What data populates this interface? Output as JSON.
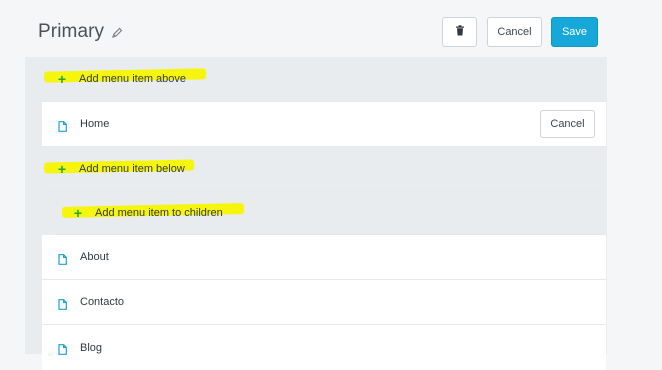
{
  "header": {
    "title": "Primary",
    "title_icon": "pencil-icon",
    "delete_icon": "trash-icon",
    "cancel_label": "Cancel",
    "save_label": "Save"
  },
  "menu": {
    "add_above": "Add menu item above",
    "items": [
      {
        "label": "Home",
        "icon": "page-icon",
        "action_label": "Cancel"
      }
    ],
    "add_below": "Add menu item below",
    "add_children": "Add menu item to children",
    "more_items": [
      {
        "label": "About",
        "icon": "page-icon"
      },
      {
        "label": "Contacto",
        "icon": "page-icon"
      },
      {
        "label": "Blog",
        "icon": "page-icon"
      }
    ]
  },
  "colors": {
    "accent": "#16a8d8",
    "plus": "#23a638",
    "highlight": "#f6f500",
    "page_icon": "#1ba1d8"
  }
}
